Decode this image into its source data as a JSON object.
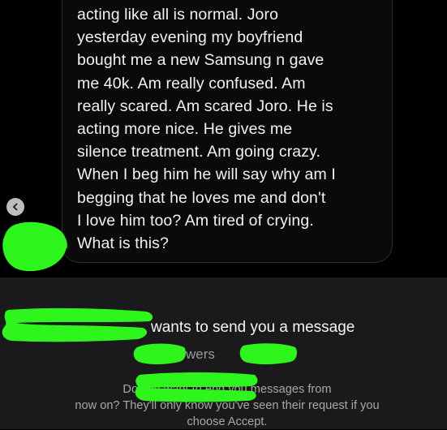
{
  "message": {
    "lines": [
      "acting like all is normal. Joro",
      "yesterday evening my boyfriend",
      "bought me a new Samsung n gave",
      "me 40k. Am really confused. Am",
      "really scared. Am scared Joro. He is",
      "acting more nice. He gives me",
      "silence treatment. Am going crazy.",
      "When I beg him he will say why am I",
      "begging that he loves me and don't",
      "I love him too? Am tired of crying.",
      "What is this?"
    ]
  },
  "request": {
    "title": "wants to send you a message",
    "followers": "llowers",
    "info_lines": [
      "Do you want to                          end you messages from",
      "now on? They'll only know you've seen their request if you",
      "choose Accept."
    ]
  },
  "icons": {
    "back": "chevron-left-icon"
  },
  "colors": {
    "background": "#000000",
    "panel": "#1a1a1c",
    "text_primary": "#f2f2f2",
    "text_secondary": "#a8a8a8",
    "redaction": "#2ef51c"
  }
}
